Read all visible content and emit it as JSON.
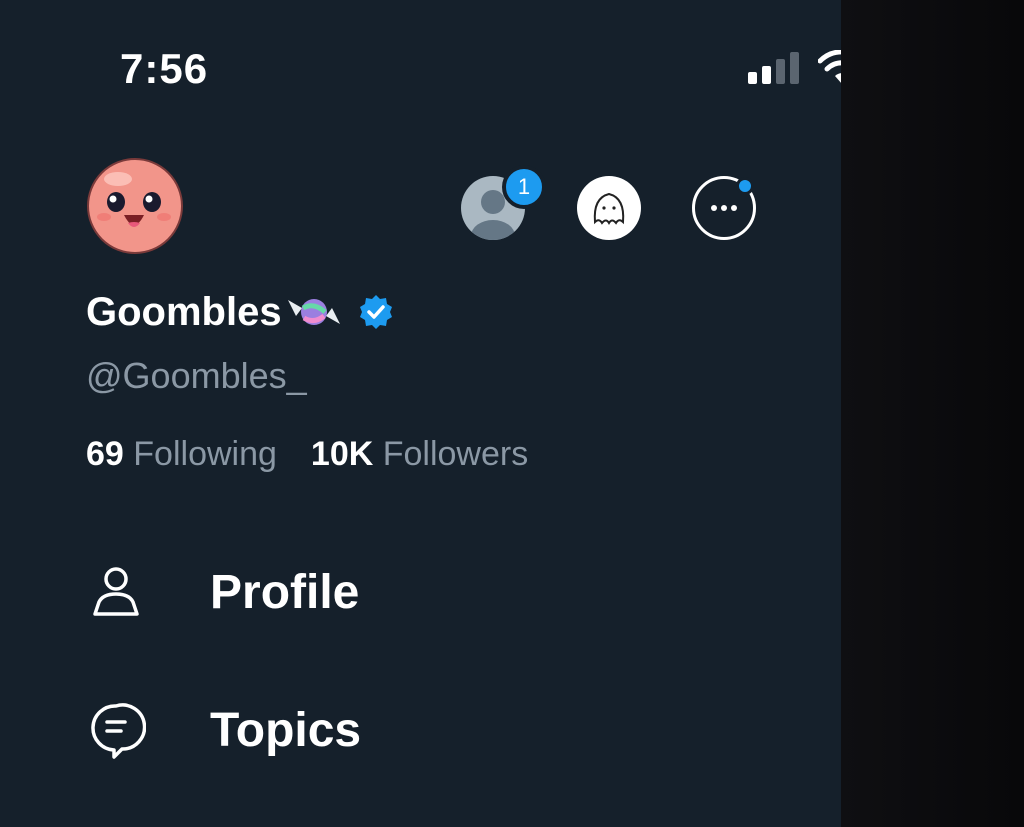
{
  "status_bar": {
    "time": "7:56",
    "signal_icon": "cellular-signal-icon",
    "wifi_icon": "wifi-icon",
    "battery_icon": "battery-icon"
  },
  "drawer": {
    "avatar_icon": "goombles-avatar",
    "accounts": [
      {
        "icon": "default-avatar-icon",
        "badge": "1"
      },
      {
        "icon": "ghost-avatar-icon"
      },
      {
        "icon": "more-icon",
        "has_dot": true
      }
    ],
    "display_name": "Goombles",
    "candy_icon": "candy-emoji-icon",
    "verified_icon": "verified-badge-icon",
    "handle": "@Goombles_",
    "following_count": "69",
    "following_label": "Following",
    "followers_count": "10K",
    "followers_label": "Followers",
    "menu": [
      {
        "icon": "person-icon",
        "label": "Profile"
      },
      {
        "icon": "topics-icon",
        "label": "Topics"
      }
    ]
  },
  "colors": {
    "drawer_bg": "#15202b",
    "accent": "#1d9bf0",
    "secondary_text": "#8b98a5",
    "avatar_pink": "#f2958a"
  }
}
